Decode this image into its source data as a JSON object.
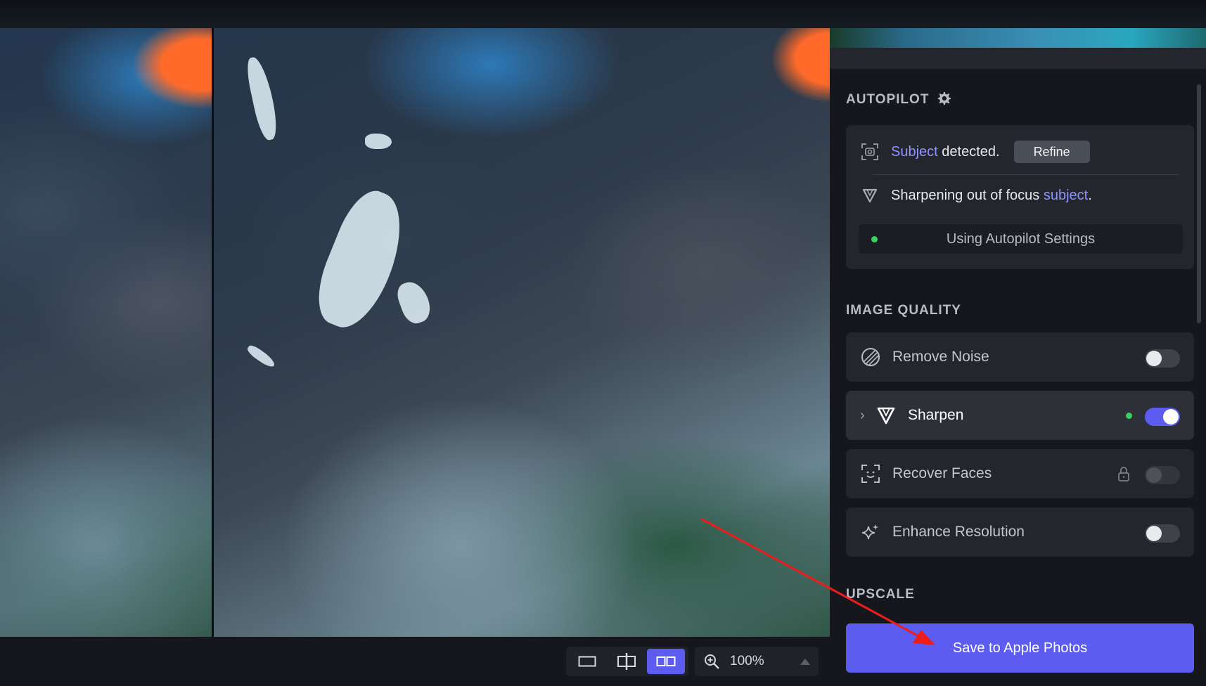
{
  "autopilot": {
    "title": "AUTOPILOT",
    "subject_link": "Subject",
    "detected_text": " detected.",
    "refine_label": "Refine",
    "sharpen_text": "Sharpening out of focus ",
    "sharpen_link": "subject",
    "sharpen_period": ".",
    "settings_label": "Using Autopilot Settings"
  },
  "image_quality": {
    "title": "IMAGE QUALITY",
    "items": [
      {
        "label": "Remove Noise",
        "icon": "noise-icon",
        "enabled": false
      },
      {
        "label": "Sharpen",
        "icon": "sharpen-icon",
        "enabled": true
      },
      {
        "label": "Recover Faces",
        "icon": "face-scan-icon",
        "enabled": false,
        "locked": true
      },
      {
        "label": "Enhance Resolution",
        "icon": "sparkle-icon",
        "enabled": false
      }
    ]
  },
  "upscale": {
    "title": "UPSCALE"
  },
  "save_label": "Save to Apple Photos",
  "view": {
    "zoom": "100%",
    "modes": [
      "single-view",
      "split-view",
      "side-by-side-view"
    ],
    "active_mode": "side-by-side-view"
  },
  "colors": {
    "accent": "#5c5cf0",
    "status_green": "#38d15e",
    "link": "#8f94ff",
    "annotation_arrow": "#ee1c1c"
  }
}
